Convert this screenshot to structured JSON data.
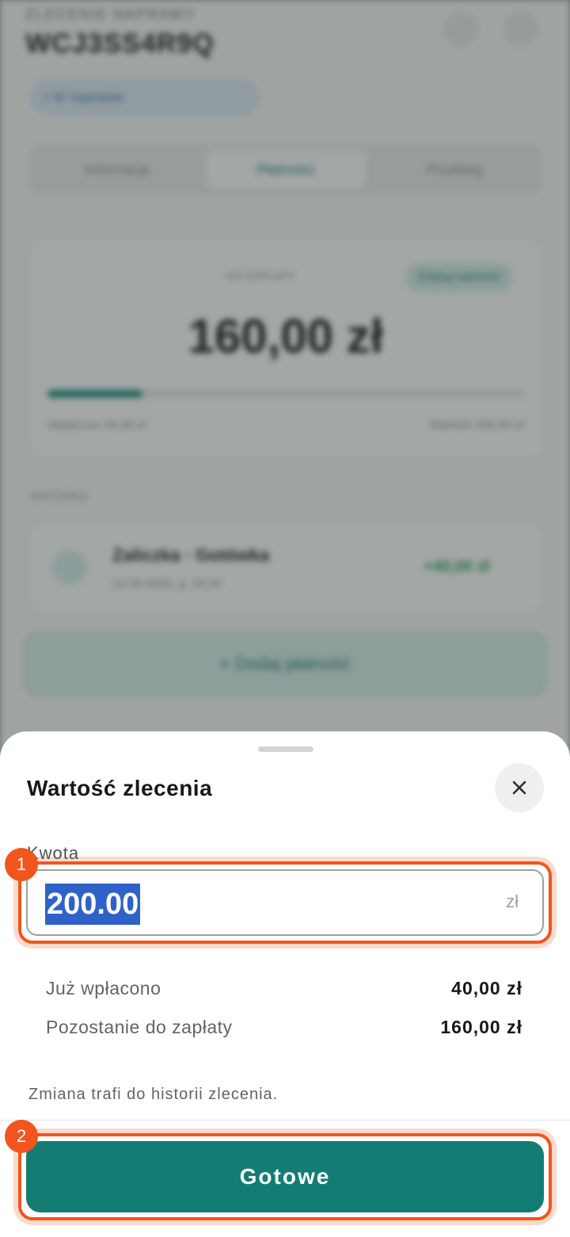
{
  "background": {
    "order_label": "ZLECENIE NAPRAWY",
    "order_code": "WCJ3SS4R9Q",
    "status_pill": "• W naprawie",
    "tabs": [
      {
        "label": "Informacje"
      },
      {
        "label": "Płatności"
      },
      {
        "label": "Przebieg"
      }
    ],
    "summary": {
      "caption": "DO ZAPŁATY",
      "edit_label": "Edytuj wartość",
      "amount": "160,00 zł",
      "progress": 0.2,
      "left_caption": "Wpłacono 40,00 zł",
      "right_caption": "Wartość 200,00 zł"
    },
    "history_label": "HISTORIA",
    "history_item": {
      "title": "Zaliczka · Gotówka",
      "subtitle": "12.05.2025, g. 10:20",
      "amount": "+40,00 zł"
    },
    "add_payment_label": "+ Dodaj płatność"
  },
  "sheet": {
    "title": "Wartość zlecenia",
    "close_icon": "close-icon",
    "field_label": "Kwota",
    "amount_value": "200.00",
    "currency": "zł",
    "rows": [
      {
        "label": "Już wpłacono",
        "value": "40,00 zł"
      },
      {
        "label": "Pozostanie do zapłaty",
        "value": "160,00 zł"
      }
    ],
    "note": "Zmiana trafi do historii zlecenia.",
    "done_label": "Gotowe"
  },
  "annotations": [
    {
      "number": "1"
    },
    {
      "number": "2"
    }
  ],
  "colors": {
    "accent": "#137d74",
    "annotation": "#f2551e",
    "selection": "#2f62c9"
  }
}
